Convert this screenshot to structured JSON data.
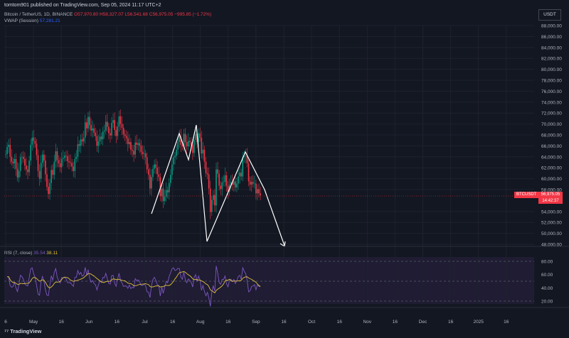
{
  "header": {
    "publisher_line": "tomtom901 published on TradingView.com, Sep 05, 2024 11:17 UTC+2"
  },
  "legend": {
    "symbol": "Bitcoin / TetherUS, 1D, BINANCE",
    "open": "O57,970.80",
    "high": "H58,327.07",
    "low": "L56,541.68",
    "close": "C56,975.05",
    "change": "−995.85 (−1.72%)",
    "vwap_label": "VWAP (Session)",
    "vwap_value": "57,281.21"
  },
  "rsi_legend": {
    "label": "RSI (7, close)",
    "rsi_value": "35.54",
    "ma_value": "38.11"
  },
  "price_axis": {
    "currency": "USDT",
    "ticks": [
      "88,000.00",
      "86,000.00",
      "84,000.00",
      "82,000.00",
      "80,000.00",
      "78,000.00",
      "76,000.00",
      "74,000.00",
      "72,000.00",
      "70,000.00",
      "68,000.00",
      "66,000.00",
      "64,000.00",
      "62,000.00",
      "60,000.00",
      "58,000.00",
      "54,000.00",
      "52,000.00",
      "50,000.00",
      "48,000.00"
    ]
  },
  "rsi_axis": {
    "ticks": [
      "80.00",
      "60.00",
      "40.00",
      "20.00"
    ]
  },
  "time_axis": {
    "ticks": [
      "6",
      "May",
      "16",
      "Jun",
      "16",
      "Jul",
      "16",
      "Aug",
      "16",
      "Sep",
      "16",
      "Oct",
      "16",
      "Nov",
      "16",
      "Dec",
      "16",
      "2025",
      "16"
    ]
  },
  "price_tag": {
    "symbol": "BTCUSDT",
    "price": "56,975.05",
    "countdown": "14:42:37"
  },
  "brand": {
    "name": "TradingView"
  },
  "chart_data": {
    "type": "candlestick",
    "ohlc_approx_closes": [
      64500,
      65800,
      66200,
      64000,
      63100,
      62800,
      63600,
      61800,
      60200,
      61400,
      63900,
      64000,
      63600,
      62400,
      61700,
      61200,
      63300,
      66200,
      67500,
      66900,
      66400,
      64300,
      61400,
      60000,
      62900,
      64400,
      63300,
      60800,
      58500,
      57200,
      59200,
      61600,
      60700,
      63100,
      65000,
      63400,
      62800,
      62100,
      63600,
      63800,
      64200,
      64100,
      63200,
      63000,
      62900,
      62200,
      61400,
      63600,
      64000,
      66300,
      66000,
      67200,
      66800,
      67500,
      70300,
      69200,
      71300,
      69800,
      68800,
      69200,
      68400,
      67800,
      66000,
      66800,
      67700,
      67200,
      68600,
      68800,
      70400,
      69500,
      68300,
      67900,
      70200,
      70700,
      68900,
      67800,
      69500,
      71400,
      70000,
      69300,
      68100,
      67800,
      67400,
      66300,
      66700,
      65300,
      65100,
      64400,
      66600,
      66200,
      66500,
      66000,
      64900,
      64500,
      64600,
      63900,
      61700,
      60700,
      58200,
      60300,
      61800,
      62600,
      62000,
      60800,
      60300,
      56800,
      58200,
      55900,
      56700,
      57900,
      57500,
      59200,
      60700,
      62600,
      63900,
      64200,
      65300,
      66700,
      67700,
      66200,
      65900,
      68200,
      66700,
      65900,
      66900,
      66700,
      66200,
      64700,
      67100,
      68200,
      66700,
      68300,
      67500,
      64600,
      65300,
      63100,
      61000,
      60800,
      58200,
      53900,
      56100,
      57000,
      55100,
      61700,
      60900,
      58700,
      58100,
      59300,
      59400,
      60600,
      58700,
      57600,
      58900,
      59400,
      58900,
      59500,
      58400,
      59100,
      60400,
      61100,
      60400,
      64000,
      64100,
      64200,
      62800,
      59500,
      58900,
      59400,
      59100,
      59100,
      57300,
      58100,
      57300,
      56975
    ],
    "overlays": [
      {
        "type": "polyline",
        "label": "pattern",
        "points": [
          [
            "Jul 03",
            53500
          ],
          [
            "Jul 22",
            68500
          ],
          [
            "Jul 25",
            63800
          ],
          [
            "Jul 29",
            70000
          ],
          [
            "Aug 27",
            49000
          ],
          [
            "Aug 27b",
            65000
          ],
          [
            "Sep 25",
            48000
          ]
        ]
      }
    ],
    "rsi_period": 7,
    "rsi_levels": [
      30,
      50,
      70
    ],
    "rsi_last": 35.54,
    "rsi_ma_last": 38.11
  }
}
